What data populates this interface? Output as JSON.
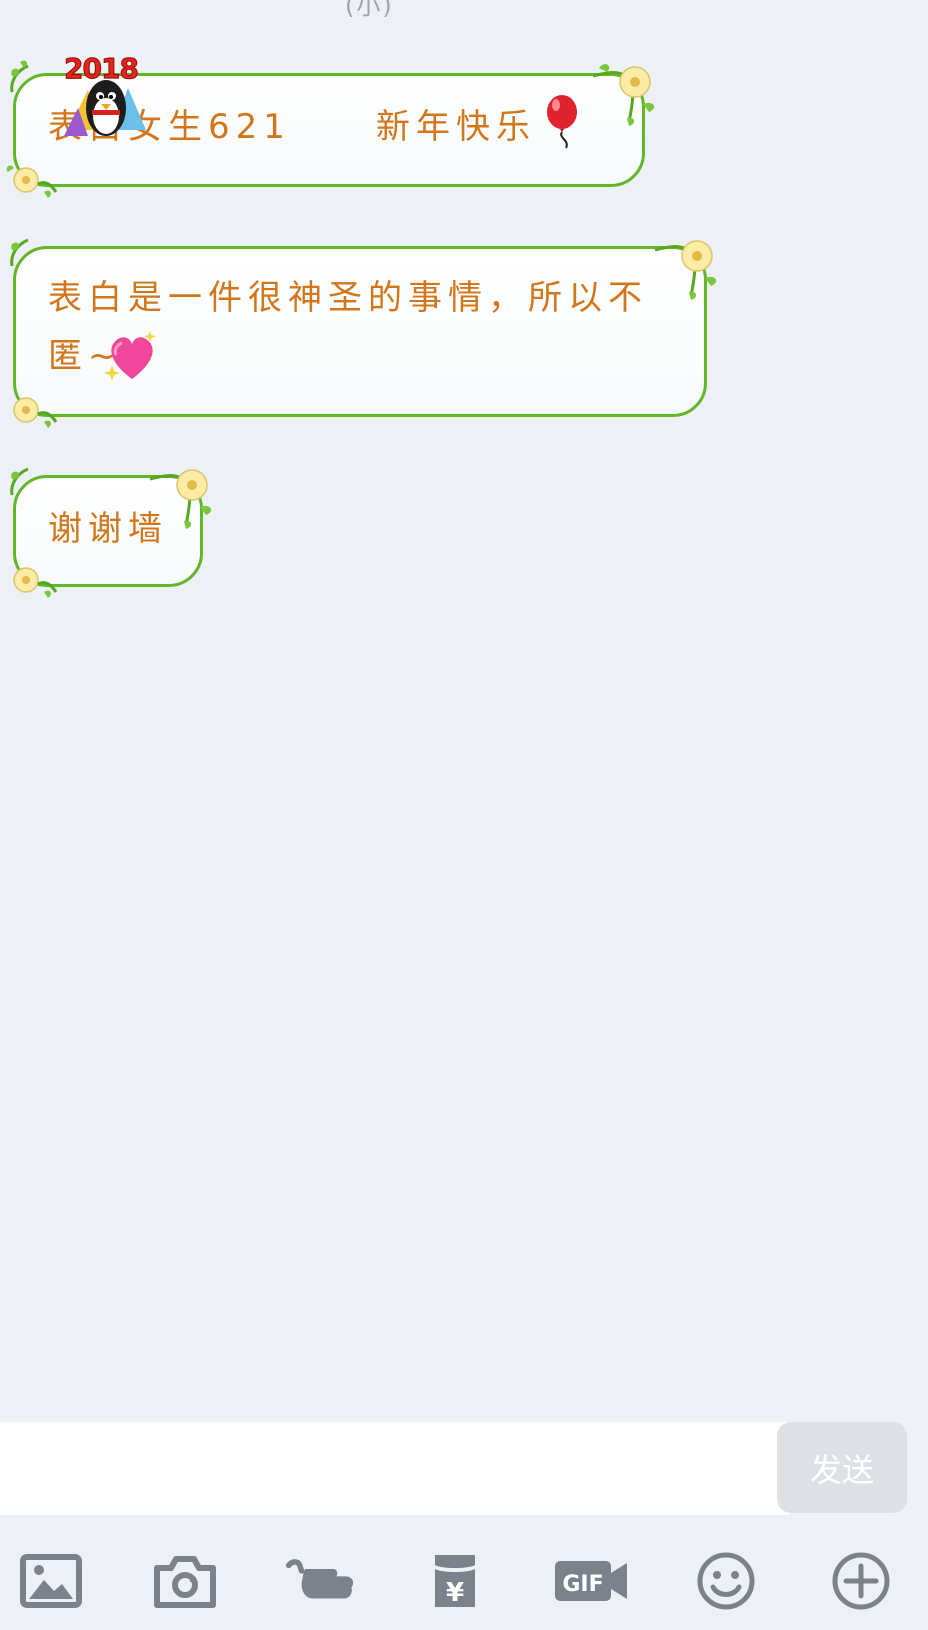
{
  "top_fragment": "(小)",
  "messages": [
    {
      "line1_left": "表白女生621",
      "line1_right": "新年快乐",
      "balloon_icon": "balloon-icon",
      "badge_text": "2018",
      "badge_icon": "penguin-2018-sticker"
    },
    {
      "line1": "表白是一件很神圣的事情，所以不",
      "line2": "匿~",
      "heart_icon": "sparkling-heart-icon"
    },
    {
      "line1": "谢谢墙"
    }
  ],
  "input": {
    "value": "",
    "placeholder": ""
  },
  "send_button": {
    "label": "发送"
  },
  "toolbar": [
    {
      "icon": "image-icon"
    },
    {
      "icon": "camera-icon"
    },
    {
      "icon": "poke-hand-icon"
    },
    {
      "icon": "red-envelope-icon",
      "label": "¥"
    },
    {
      "icon": "gif-icon",
      "label": "GIF"
    },
    {
      "icon": "emoji-icon"
    },
    {
      "icon": "plus-icon"
    }
  ],
  "colors": {
    "background": "#edf1f6",
    "bubble_border": "#63b52a",
    "bubble_text": "#d2761b",
    "icon_gray": "#7c828b",
    "send_bg": "#dde1e6"
  }
}
